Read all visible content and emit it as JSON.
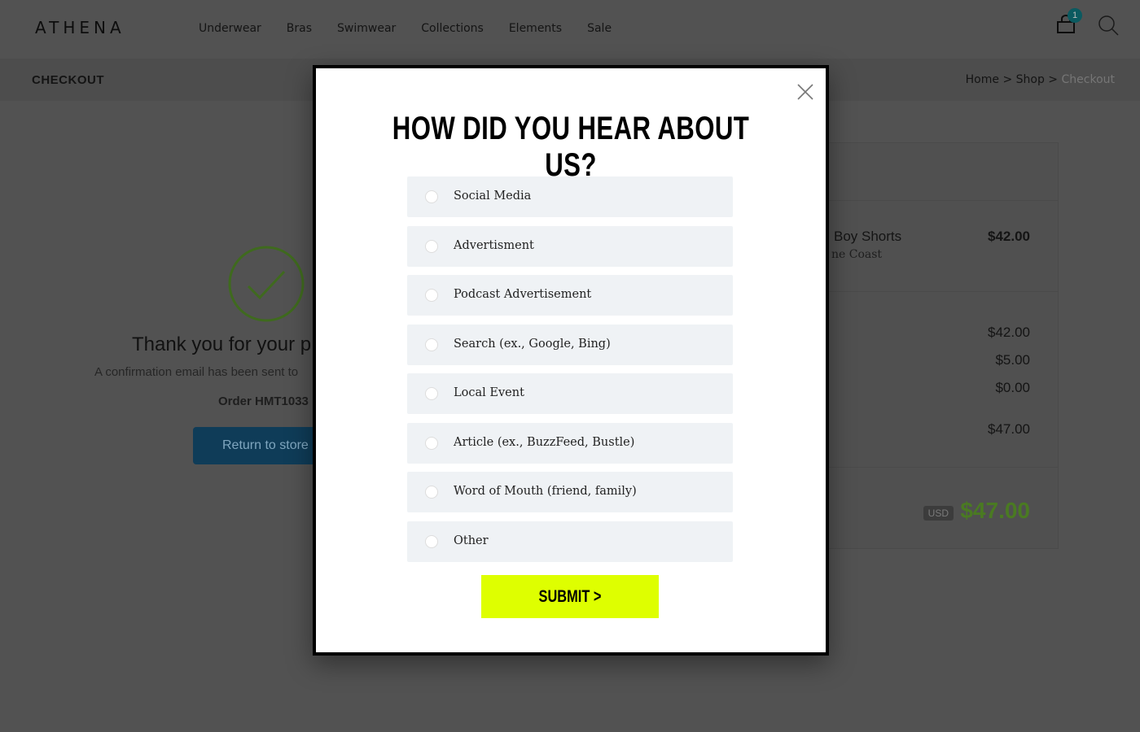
{
  "header": {
    "logo": "ATHENA",
    "nav": [
      "Underwear",
      "Bras",
      "Swimwear",
      "Collections",
      "Elements",
      "Sale"
    ],
    "cart_count": "1"
  },
  "bar": {
    "title": "CHECKOUT",
    "breadcrumb": [
      "Home",
      "Shop",
      "Checkout"
    ]
  },
  "confirmation": {
    "title": "Thank you for your p",
    "message": "A confirmation email has been sent to",
    "order": "Order HMT1033",
    "return_button": "Return to store",
    "check_color": "#7ac142"
  },
  "summary": {
    "item_name": "Boy Shorts",
    "item_variant": "ne Coast",
    "item_price": "$42.00",
    "subtotal": "$42.00",
    "shipping": "$5.00",
    "tax": "$0.00",
    "total_line": "$47.00",
    "currency": "USD",
    "grand_total": "$47.00"
  },
  "modal": {
    "title": "HOW DID YOU HEAR ABOUT US?",
    "options": [
      "Social Media",
      "Advertisment",
      "Podcast Advertisement",
      "Search (ex., Google, Bing)",
      "Local Event",
      "Article (ex., BuzzFeed, Bustle)",
      "Word of Mouth (friend, family)",
      "Other"
    ],
    "submit": "SUBMIT >",
    "submit_color": "#deff00"
  }
}
